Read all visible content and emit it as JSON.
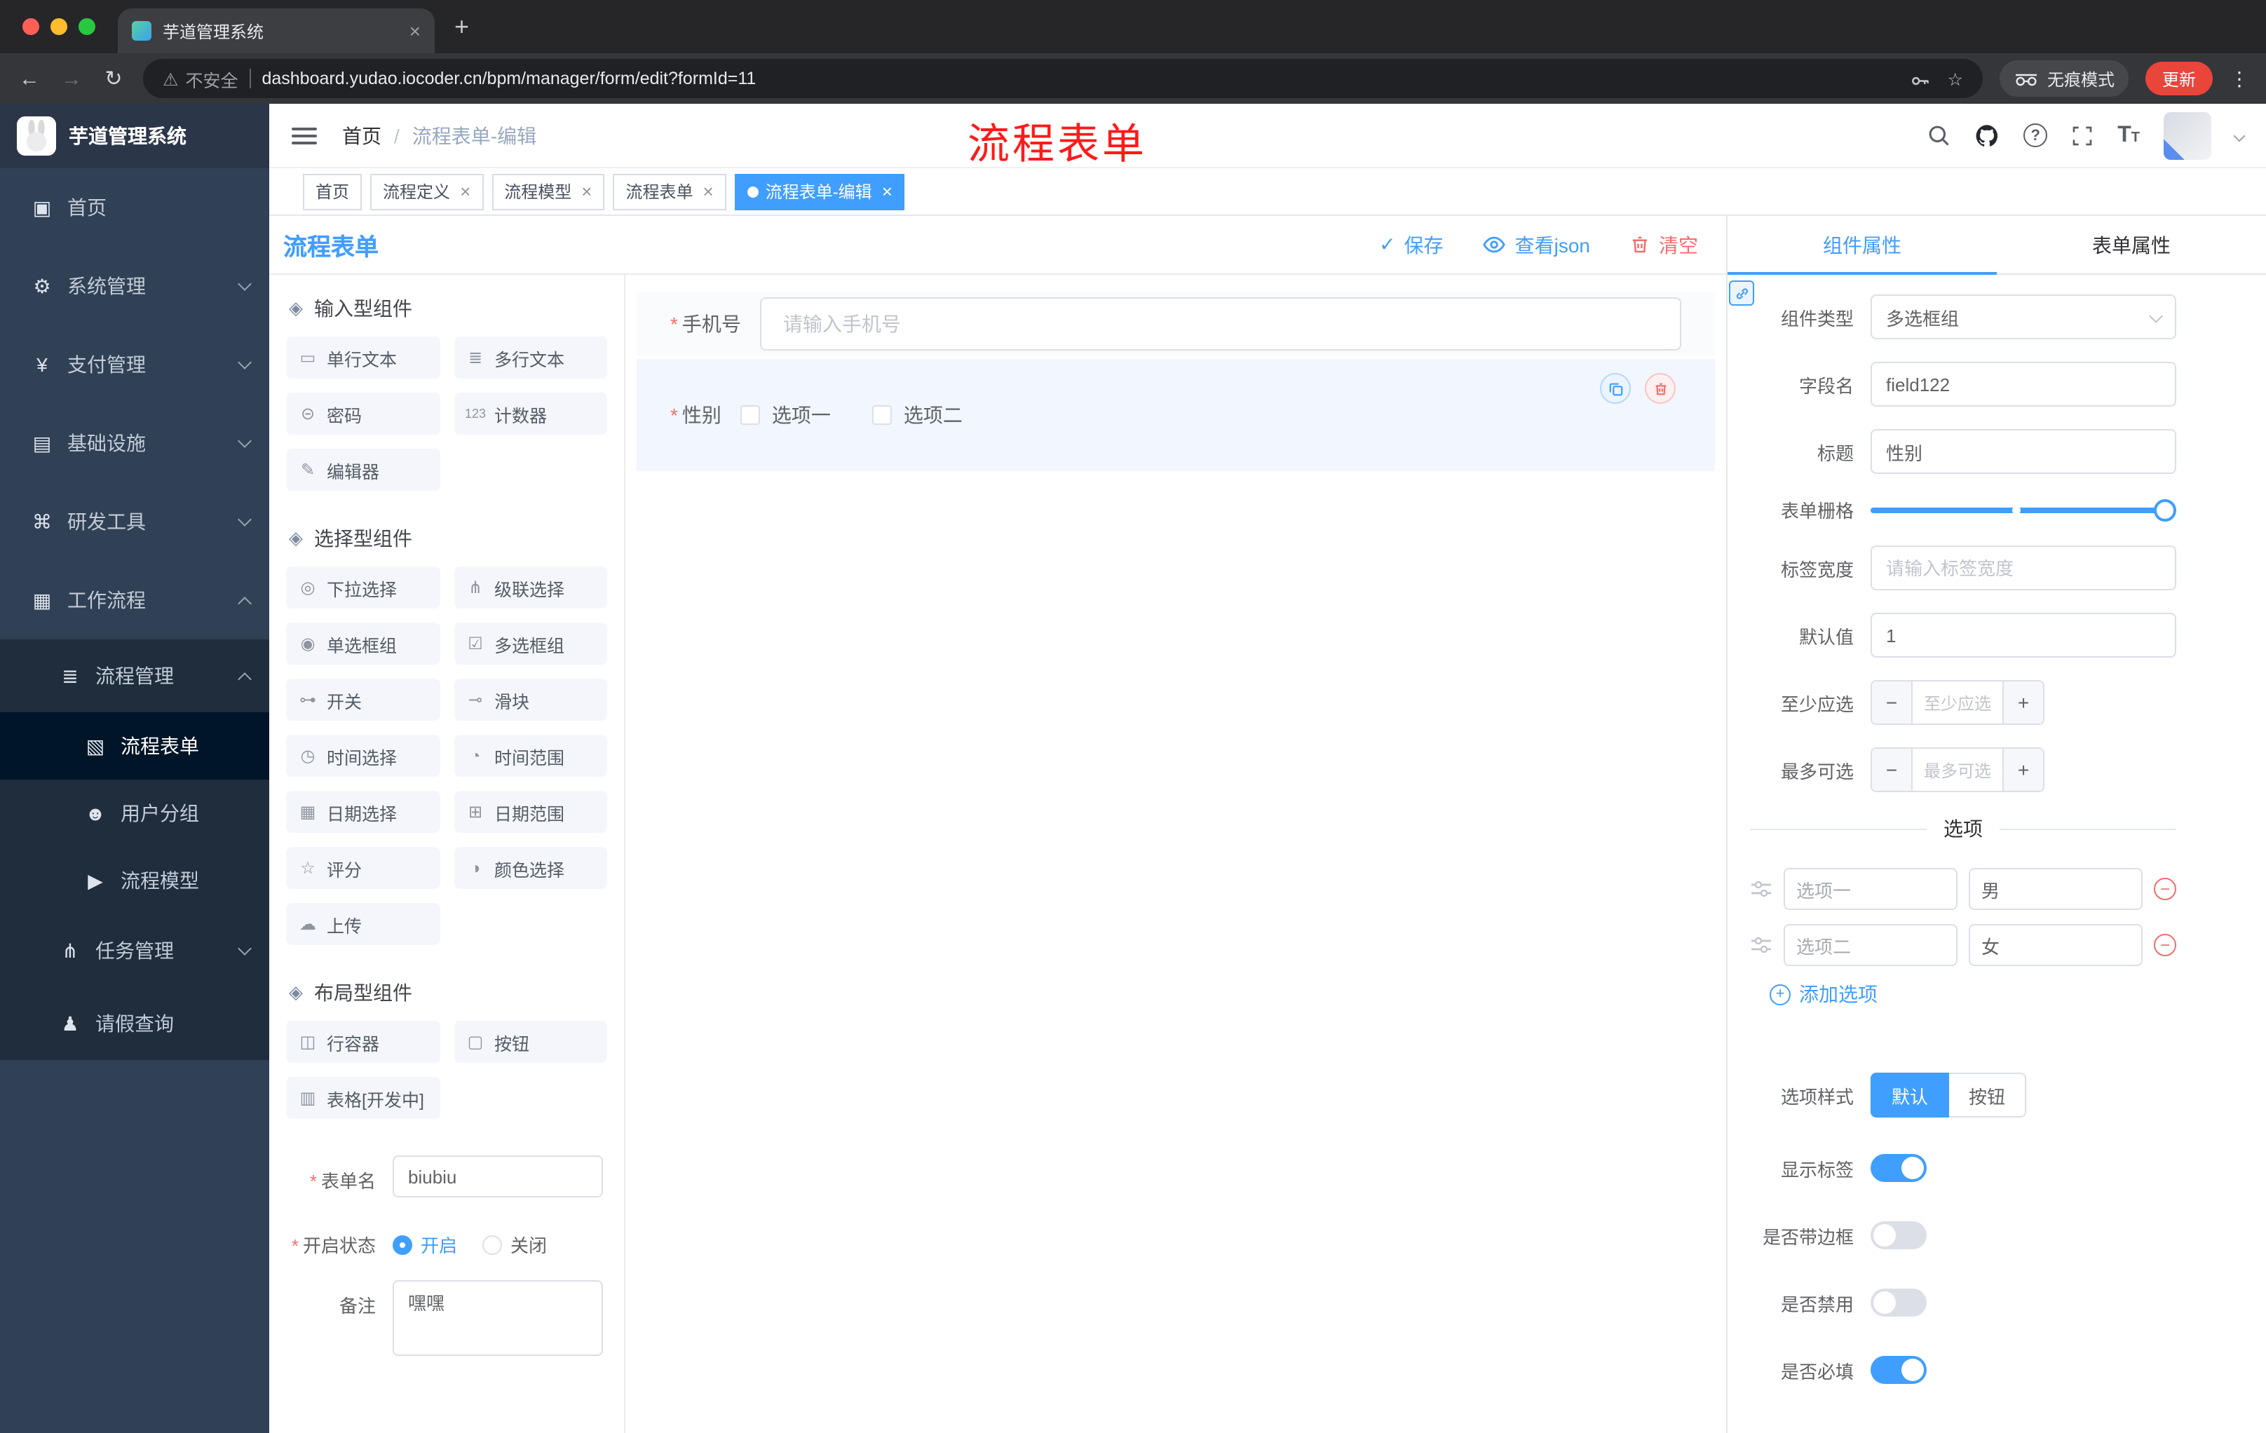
{
  "browser": {
    "tab_title": "芋道管理系统",
    "security_label": "不安全",
    "url": "dashboard.yudao.iocoder.cn/bpm/manager/form/edit?formId=11",
    "incognito_label": "无痕模式",
    "update_label": "更新"
  },
  "header": {
    "breadcrumb_home": "首页",
    "breadcrumb_separator": "/",
    "breadcrumb_current": "流程表单-编辑",
    "overlay_title": "流程表单"
  },
  "sidebar": {
    "logo_title": "芋道管理系统",
    "menu": [
      {
        "icon": "▣",
        "label": "首页"
      },
      {
        "icon": "⚙",
        "label": "系统管理"
      },
      {
        "icon": "¥",
        "label": "支付管理"
      },
      {
        "icon": "▤",
        "label": "基础设施"
      },
      {
        "icon": "⌘",
        "label": "研发工具"
      },
      {
        "icon": "▦",
        "label": "工作流程"
      }
    ],
    "submenu": {
      "process": {
        "icon": "≣",
        "label": "流程管理"
      },
      "children": [
        {
          "icon": "▧",
          "label": "流程表单"
        },
        {
          "icon": "☻",
          "label": "用户分组"
        },
        {
          "icon": "▶",
          "label": "流程模型"
        }
      ],
      "task": {
        "icon": "⋔",
        "label": "任务管理"
      },
      "leave": {
        "icon": "♟",
        "label": "请假查询"
      }
    }
  },
  "tags": [
    {
      "label": "首页"
    },
    {
      "label": "流程定义"
    },
    {
      "label": "流程模型"
    },
    {
      "label": "流程表单"
    },
    {
      "label": "流程表单-编辑"
    }
  ],
  "toolbar": {
    "title": "流程表单",
    "save": "保存",
    "view_json": "查看json",
    "clear": "清空"
  },
  "palette": {
    "groups": [
      {
        "title": "输入型组件",
        "items": [
          {
            "icon": "▭",
            "label": "单行文本"
          },
          {
            "icon": "≣",
            "label": "多行文本"
          },
          {
            "icon": "⊝",
            "label": "密码"
          },
          {
            "icon": "123",
            "label": "计数器"
          },
          {
            "icon": "✎",
            "label": "编辑器"
          }
        ]
      },
      {
        "title": "选择型组件",
        "items": [
          {
            "icon": "◎",
            "label": "下拉选择"
          },
          {
            "icon": "⋔",
            "label": "级联选择"
          },
          {
            "icon": "◉",
            "label": "单选框组"
          },
          {
            "icon": "☑",
            "label": "多选框组"
          },
          {
            "icon": "⊶",
            "label": "开关"
          },
          {
            "icon": "⊸",
            "label": "滑块"
          },
          {
            "icon": "◷",
            "label": "时间选择"
          },
          {
            "icon": "◔",
            "label": "时间范围"
          },
          {
            "icon": "▦",
            "label": "日期选择"
          },
          {
            "icon": "⊞",
            "label": "日期范围"
          },
          {
            "icon": "☆",
            "label": "评分"
          },
          {
            "icon": "◑",
            "label": "颜色选择"
          },
          {
            "icon": "☁",
            "label": "上传"
          }
        ]
      },
      {
        "title": "布局型组件",
        "items": [
          {
            "icon": "◫",
            "label": "行容器"
          },
          {
            "icon": "▢",
            "label": "按钮"
          },
          {
            "icon": "▥",
            "label": "表格[开发中]"
          }
        ]
      }
    ]
  },
  "palette_form": {
    "name_label": "表单名",
    "name_value": "biubiu",
    "status_label": "开启状态",
    "status_on": "开启",
    "status_off": "关闭",
    "remark_label": "备注",
    "remark_value": "嘿嘿"
  },
  "canvas": {
    "phone_label": "手机号",
    "phone_placeholder": "请输入手机号",
    "gender_label": "性别",
    "gender_options": [
      "选项一",
      "选项二"
    ]
  },
  "panel": {
    "tabs": [
      "组件属性",
      "表单属性"
    ],
    "component_type_label": "组件类型",
    "component_type_value": "多选框组",
    "field_label": "字段名",
    "field_value": "field122",
    "title_label": "标题",
    "title_value": "性别",
    "grid_label": "表单栅格",
    "label_width_label": "标签宽度",
    "label_width_placeholder": "请输入标签宽度",
    "default_label": "默认值",
    "default_value": "1",
    "min_label": "至少应选",
    "min_placeholder": "至少应选",
    "max_label": "最多可选",
    "max_placeholder": "最多可选",
    "options_divider": "选项",
    "options": [
      {
        "label": "选项一",
        "value": "男"
      },
      {
        "label": "选项二",
        "value": "女"
      }
    ],
    "add_option": "添加选项",
    "style_label": "选项样式",
    "style_default": "默认",
    "style_button": "按钮",
    "switches": [
      {
        "label": "显示标签",
        "state": "on"
      },
      {
        "label": "是否带边框",
        "state": "off"
      },
      {
        "label": "是否禁用",
        "state": "off"
      },
      {
        "label": "是否必填",
        "state": "on"
      }
    ]
  },
  "icons": {
    "close": "×",
    "plus": "+",
    "minus": "−",
    "back": "←",
    "forward": "→",
    "reload": "↻",
    "warning": "⚠",
    "star": "☆",
    "kebab": "⋮",
    "check": "✓",
    "question": "?",
    "group_handle": "◈",
    "letter_t": "T"
  },
  "colors": {
    "accent": "#409EFF",
    "danger": "#F56C6C",
    "overlay_red": "#FE1A1A",
    "sidebar_bg": "#304156",
    "submenu_bg": "#1F2D3D"
  }
}
